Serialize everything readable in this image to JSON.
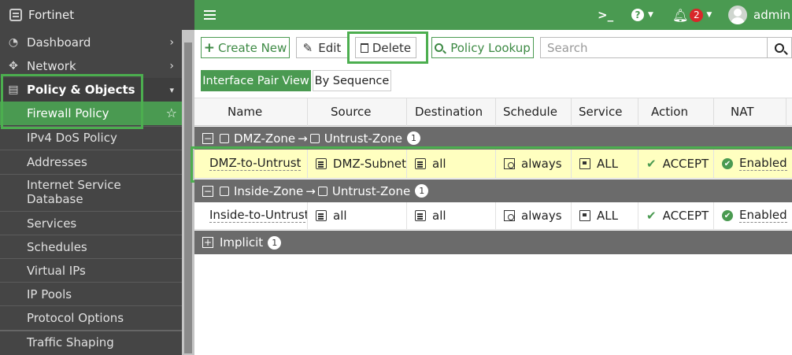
{
  "brand": {
    "title": "Fortinet"
  },
  "sidebar": {
    "items": [
      {
        "label": "Dashboard",
        "icon": "dashboard-icon"
      },
      {
        "label": "Network",
        "icon": "network-icon"
      },
      {
        "label": "Policy & Objects",
        "icon": "policy-icon"
      }
    ],
    "subitems": [
      "Firewall Policy",
      "IPv4 DoS Policy",
      "Addresses",
      "Internet Service",
      "Database",
      "Services",
      "Schedules",
      "Virtual IPs",
      "IP Pools",
      "Protocol Options",
      "Traffic Shaping"
    ]
  },
  "topbar": {
    "cli_icon": ">_",
    "help_icon": "?",
    "notifications_count": "2",
    "user": "admin"
  },
  "toolbar": {
    "create_new": "Create New",
    "edit": "Edit",
    "delete": "Delete",
    "policy_lookup": "Policy Lookup",
    "search_placeholder": "Search"
  },
  "view_tabs": {
    "interface_pair": "Interface Pair View",
    "by_sequence": "By Sequence"
  },
  "table": {
    "columns": [
      "Name",
      "Source",
      "Destination",
      "Schedule",
      "Service",
      "Action",
      "NAT"
    ],
    "groups": [
      {
        "from": "DMZ-Zone",
        "to": "Untrust-Zone",
        "count": "1",
        "rows": [
          {
            "name": "DMZ-to-Untrust",
            "source": "DMZ-Subnet",
            "destination": "all",
            "schedule": "always",
            "service": "ALL",
            "action": "ACCEPT",
            "nat": "Enabled"
          }
        ]
      },
      {
        "from": "Inside-Zone",
        "to": "Untrust-Zone",
        "count": "1",
        "rows": [
          {
            "name": "Inside-to-Untrust",
            "source": "all",
            "destination": "all",
            "schedule": "always",
            "service": "ALL",
            "action": "ACCEPT",
            "nat": "Enabled"
          }
        ]
      }
    ],
    "implicit": {
      "label": "Implicit",
      "count": "1"
    }
  },
  "arrow": "→",
  "colors": {
    "brand_green": "#4a9a51",
    "sidebar_bg": "#454545",
    "highlight_row": "#ffffc0",
    "group_bg": "#6b6b6b"
  }
}
